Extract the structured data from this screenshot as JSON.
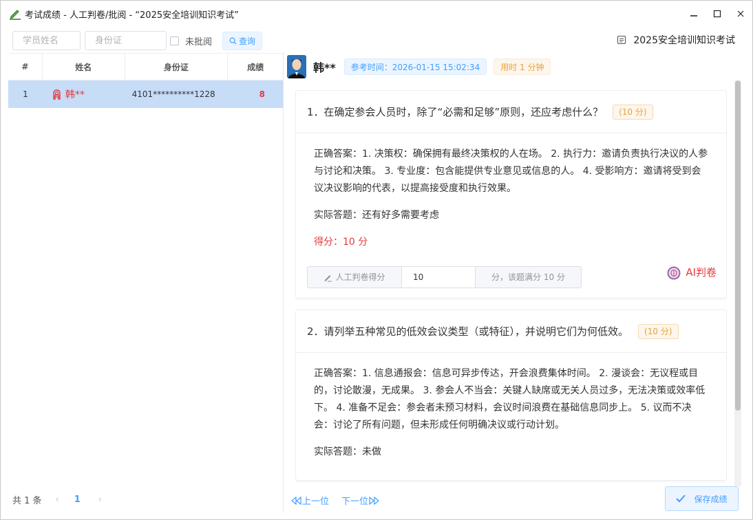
{
  "window": {
    "title": "考试成绩 - 人工判卷/批阅 - “2025安全培训知识考试”",
    "controls": [
      "minimize",
      "maximize",
      "close"
    ]
  },
  "toolbar": {
    "name_placeholder": "学员姓名",
    "id_placeholder": "身份证",
    "unreviewed_label": "未批阅",
    "search_label": "查询",
    "exam_name": "2025安全培训知识考试"
  },
  "table": {
    "headers": [
      "#",
      "姓名",
      "身份证",
      "成绩"
    ],
    "rows": [
      {
        "no": "1",
        "name": "韩**",
        "id": "4101**********1228",
        "score": "8"
      }
    ]
  },
  "pager": {
    "total": "共 1 条",
    "prev": "‹",
    "current": "1",
    "next": "›"
  },
  "student": {
    "name": "韩**",
    "exam_time": "参考时间：2026-01-15 15:02:34",
    "duration": "用时 1 分钟"
  },
  "questions": [
    {
      "title": "1．在确定参会人员时，除了“必需和足够”原则，还应考虑什么？",
      "points": "(10 分)",
      "correct_answer": "正确答案：1. 决策权：确保拥有最终决策权的人在场。 2. 执行力：邀请负责执行决议的人参与讨论和决策。 3. 专业度：包含能提供专业意见或信息的人。 4. 受影响方：邀请将受到会议决议影响的代表，以提高接受度和执行效果。",
      "actual_answer": "实际答题：还有好多需要考虑",
      "score": "得分：10 分",
      "grade_label": "人工判卷得分",
      "grade_value": "10",
      "grade_suffix": "分，该题满分 10 分",
      "ai_label": "AI判卷"
    },
    {
      "title": "2．请列举五种常见的低效会议类型（或特征），并说明它们为何低效。",
      "points": "(10 分)",
      "correct_answer": "正确答案：1. 信息通报会：信息可异步传达，开会浪费集体时间。 2. 漫谈会：无议程或目的，讨论散漫，无成果。 3. 参会人不当会：关键人缺席或无关人员过多，无法决策或效率低下。 4. 准备不足会：参会者未预习材料，会议时间浪费在基础信息同步上。 5. 议而不决会：讨论了所有问题，但未形成任何明确决议或行动计划。",
      "actual_answer": "实际答题：未做"
    }
  ],
  "nav": {
    "prev": "上一位",
    "next": "下一位"
  },
  "save_label": "保存成绩",
  "colors": {
    "accent": "#409eff",
    "danger": "#e4393c",
    "warning": "#e6a23c",
    "selected_row": "#c6dcf7"
  }
}
